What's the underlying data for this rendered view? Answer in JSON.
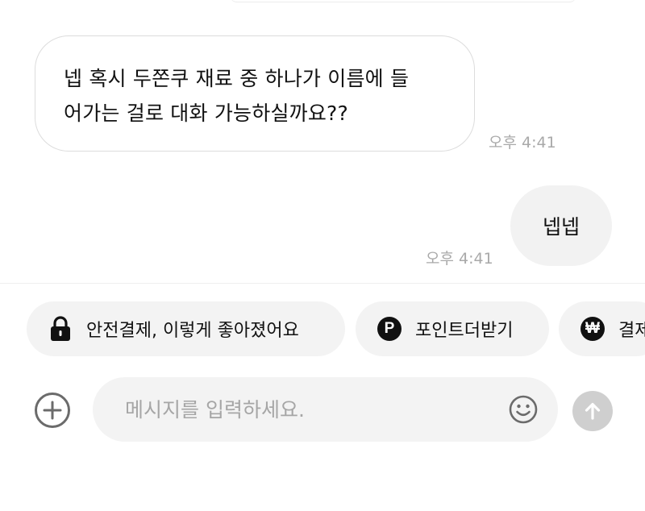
{
  "messages": [
    {
      "direction": "incoming",
      "text": "넵 혹시 두쫀쿠 재료 중 하나가 이름에 들\n어가는 걸로 대화 가능하실까요??",
      "time": "오후 4:41"
    },
    {
      "direction": "outgoing",
      "text": "넵넵",
      "time": "오후 4:41"
    }
  ],
  "quick_actions": [
    {
      "label": "안전결제, 이렇게 좋아졌어요",
      "icon": "lock-icon"
    },
    {
      "label": "포인트더받기",
      "icon": "point-p-icon",
      "icon_text": "P"
    },
    {
      "label": "결제",
      "icon": "won-icon",
      "icon_text": "₩"
    }
  ],
  "composer": {
    "placeholder": "메시지를 입력하세요.",
    "value": "",
    "add_icon": "plus-circle-icon",
    "emoji_icon": "smiley-icon",
    "send_icon": "arrow-up-icon"
  },
  "colors": {
    "background": "#ffffff",
    "incoming_bubble_border": "#dcdcdc",
    "outgoing_bubble_bg": "#f2f2f2",
    "chip_bg": "#f3f3f3",
    "timestamp": "#a9a9a9",
    "send_button_disabled": "#cfcfcf"
  }
}
